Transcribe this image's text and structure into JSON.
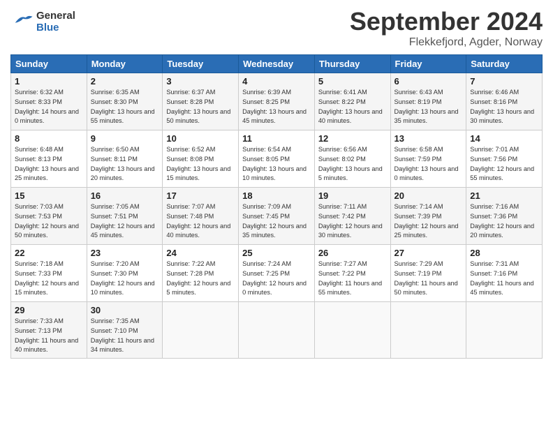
{
  "header": {
    "logo_text_general": "General",
    "logo_text_blue": "Blue",
    "month_title": "September 2024",
    "location": "Flekkefjord, Agder, Norway"
  },
  "days_of_week": [
    "Sunday",
    "Monday",
    "Tuesday",
    "Wednesday",
    "Thursday",
    "Friday",
    "Saturday"
  ],
  "weeks": [
    [
      {
        "day": "1",
        "sunrise": "Sunrise: 6:32 AM",
        "sunset": "Sunset: 8:33 PM",
        "daylight": "Daylight: 14 hours and 0 minutes."
      },
      {
        "day": "2",
        "sunrise": "Sunrise: 6:35 AM",
        "sunset": "Sunset: 8:30 PM",
        "daylight": "Daylight: 13 hours and 55 minutes."
      },
      {
        "day": "3",
        "sunrise": "Sunrise: 6:37 AM",
        "sunset": "Sunset: 8:28 PM",
        "daylight": "Daylight: 13 hours and 50 minutes."
      },
      {
        "day": "4",
        "sunrise": "Sunrise: 6:39 AM",
        "sunset": "Sunset: 8:25 PM",
        "daylight": "Daylight: 13 hours and 45 minutes."
      },
      {
        "day": "5",
        "sunrise": "Sunrise: 6:41 AM",
        "sunset": "Sunset: 8:22 PM",
        "daylight": "Daylight: 13 hours and 40 minutes."
      },
      {
        "day": "6",
        "sunrise": "Sunrise: 6:43 AM",
        "sunset": "Sunset: 8:19 PM",
        "daylight": "Daylight: 13 hours and 35 minutes."
      },
      {
        "day": "7",
        "sunrise": "Sunrise: 6:46 AM",
        "sunset": "Sunset: 8:16 PM",
        "daylight": "Daylight: 13 hours and 30 minutes."
      }
    ],
    [
      {
        "day": "8",
        "sunrise": "Sunrise: 6:48 AM",
        "sunset": "Sunset: 8:13 PM",
        "daylight": "Daylight: 13 hours and 25 minutes."
      },
      {
        "day": "9",
        "sunrise": "Sunrise: 6:50 AM",
        "sunset": "Sunset: 8:11 PM",
        "daylight": "Daylight: 13 hours and 20 minutes."
      },
      {
        "day": "10",
        "sunrise": "Sunrise: 6:52 AM",
        "sunset": "Sunset: 8:08 PM",
        "daylight": "Daylight: 13 hours and 15 minutes."
      },
      {
        "day": "11",
        "sunrise": "Sunrise: 6:54 AM",
        "sunset": "Sunset: 8:05 PM",
        "daylight": "Daylight: 13 hours and 10 minutes."
      },
      {
        "day": "12",
        "sunrise": "Sunrise: 6:56 AM",
        "sunset": "Sunset: 8:02 PM",
        "daylight": "Daylight: 13 hours and 5 minutes."
      },
      {
        "day": "13",
        "sunrise": "Sunrise: 6:58 AM",
        "sunset": "Sunset: 7:59 PM",
        "daylight": "Daylight: 13 hours and 0 minutes."
      },
      {
        "day": "14",
        "sunrise": "Sunrise: 7:01 AM",
        "sunset": "Sunset: 7:56 PM",
        "daylight": "Daylight: 12 hours and 55 minutes."
      }
    ],
    [
      {
        "day": "15",
        "sunrise": "Sunrise: 7:03 AM",
        "sunset": "Sunset: 7:53 PM",
        "daylight": "Daylight: 12 hours and 50 minutes."
      },
      {
        "day": "16",
        "sunrise": "Sunrise: 7:05 AM",
        "sunset": "Sunset: 7:51 PM",
        "daylight": "Daylight: 12 hours and 45 minutes."
      },
      {
        "day": "17",
        "sunrise": "Sunrise: 7:07 AM",
        "sunset": "Sunset: 7:48 PM",
        "daylight": "Daylight: 12 hours and 40 minutes."
      },
      {
        "day": "18",
        "sunrise": "Sunrise: 7:09 AM",
        "sunset": "Sunset: 7:45 PM",
        "daylight": "Daylight: 12 hours and 35 minutes."
      },
      {
        "day": "19",
        "sunrise": "Sunrise: 7:11 AM",
        "sunset": "Sunset: 7:42 PM",
        "daylight": "Daylight: 12 hours and 30 minutes."
      },
      {
        "day": "20",
        "sunrise": "Sunrise: 7:14 AM",
        "sunset": "Sunset: 7:39 PM",
        "daylight": "Daylight: 12 hours and 25 minutes."
      },
      {
        "day": "21",
        "sunrise": "Sunrise: 7:16 AM",
        "sunset": "Sunset: 7:36 PM",
        "daylight": "Daylight: 12 hours and 20 minutes."
      }
    ],
    [
      {
        "day": "22",
        "sunrise": "Sunrise: 7:18 AM",
        "sunset": "Sunset: 7:33 PM",
        "daylight": "Daylight: 12 hours and 15 minutes."
      },
      {
        "day": "23",
        "sunrise": "Sunrise: 7:20 AM",
        "sunset": "Sunset: 7:30 PM",
        "daylight": "Daylight: 12 hours and 10 minutes."
      },
      {
        "day": "24",
        "sunrise": "Sunrise: 7:22 AM",
        "sunset": "Sunset: 7:28 PM",
        "daylight": "Daylight: 12 hours and 5 minutes."
      },
      {
        "day": "25",
        "sunrise": "Sunrise: 7:24 AM",
        "sunset": "Sunset: 7:25 PM",
        "daylight": "Daylight: 12 hours and 0 minutes."
      },
      {
        "day": "26",
        "sunrise": "Sunrise: 7:27 AM",
        "sunset": "Sunset: 7:22 PM",
        "daylight": "Daylight: 11 hours and 55 minutes."
      },
      {
        "day": "27",
        "sunrise": "Sunrise: 7:29 AM",
        "sunset": "Sunset: 7:19 PM",
        "daylight": "Daylight: 11 hours and 50 minutes."
      },
      {
        "day": "28",
        "sunrise": "Sunrise: 7:31 AM",
        "sunset": "Sunset: 7:16 PM",
        "daylight": "Daylight: 11 hours and 45 minutes."
      }
    ],
    [
      {
        "day": "29",
        "sunrise": "Sunrise: 7:33 AM",
        "sunset": "Sunset: 7:13 PM",
        "daylight": "Daylight: 11 hours and 40 minutes."
      },
      {
        "day": "30",
        "sunrise": "Sunrise: 7:35 AM",
        "sunset": "Sunset: 7:10 PM",
        "daylight": "Daylight: 11 hours and 34 minutes."
      },
      {
        "day": "",
        "sunrise": "",
        "sunset": "",
        "daylight": ""
      },
      {
        "day": "",
        "sunrise": "",
        "sunset": "",
        "daylight": ""
      },
      {
        "day": "",
        "sunrise": "",
        "sunset": "",
        "daylight": ""
      },
      {
        "day": "",
        "sunrise": "",
        "sunset": "",
        "daylight": ""
      },
      {
        "day": "",
        "sunrise": "",
        "sunset": "",
        "daylight": ""
      }
    ]
  ]
}
